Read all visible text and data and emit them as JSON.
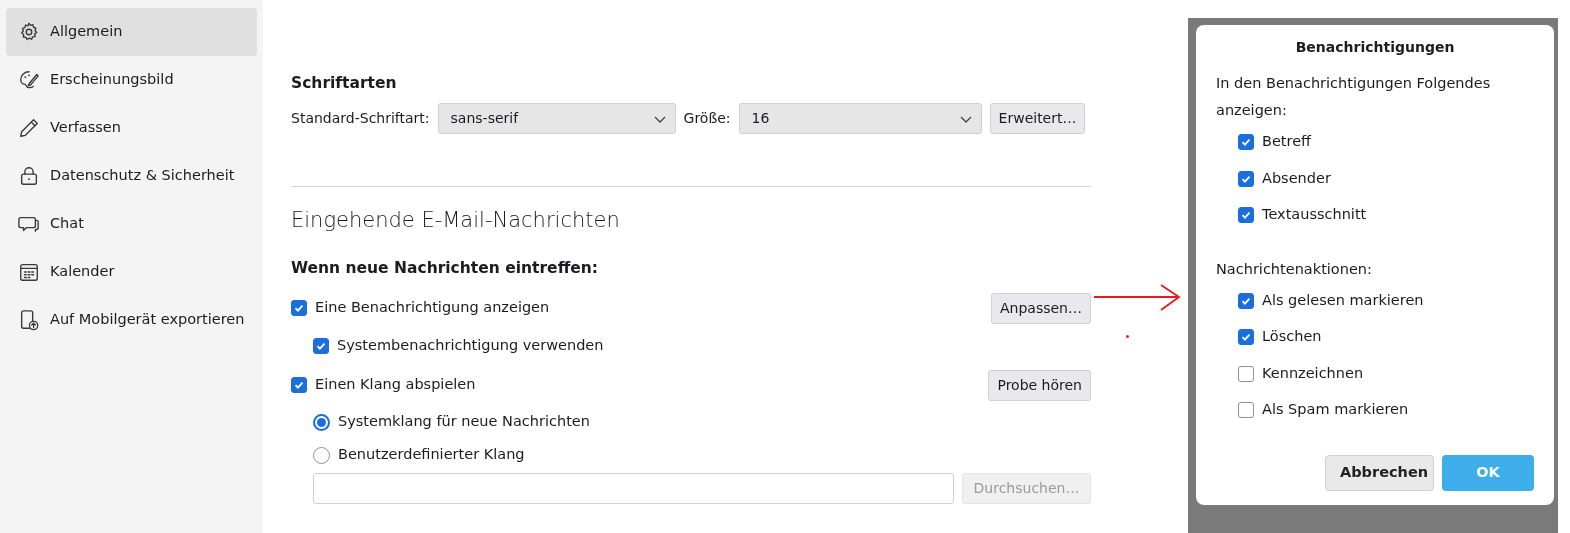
{
  "sidebar": {
    "items": [
      {
        "label": "Allgemein",
        "selected": true
      },
      {
        "label": "Erscheinungsbild",
        "selected": false
      },
      {
        "label": "Verfassen",
        "selected": false
      },
      {
        "label": "Datenschutz & Sicherheit",
        "selected": false
      },
      {
        "label": "Chat",
        "selected": false
      },
      {
        "label": "Kalender",
        "selected": false
      },
      {
        "label": "Auf Mobilgerät exportieren",
        "selected": false
      }
    ]
  },
  "fonts": {
    "heading": "Schriftarten",
    "default_font": {
      "label": "Standard-Schriftart:",
      "value": "sans-serif"
    },
    "size": {
      "label": "Größe:",
      "value": "16"
    },
    "advanced_button": "Erweitert…"
  },
  "incoming": {
    "heading": "Eingehende E-Mail-Nachrichten",
    "subheading": "Wenn neue Nachrichten eintreffen:",
    "show_alert": {
      "label": "Eine Benachrichtigung anzeigen",
      "checked": true,
      "button": "Anpassen…"
    },
    "system_notification": {
      "label": "Systembenachrichtigung verwenden",
      "checked": true
    },
    "play_sound": {
      "label": "Einen Klang abspielen",
      "checked": true,
      "button": "Probe hören"
    },
    "sound_choices": [
      {
        "label": "Systemklang für neue Nachrichten",
        "selected": true
      },
      {
        "label": "Benutzerdefinierter Klang",
        "selected": false
      }
    ],
    "sound_file": {
      "browse_button": "Durchsuchen…",
      "disabled": true
    }
  },
  "dialog": {
    "title": "Benachrichtigungen",
    "show_label": "In den Benachrichtigungen Folgendes anzeigen:",
    "show_items": [
      {
        "label": "Betreff",
        "checked": true
      },
      {
        "label": "Absender",
        "checked": true
      },
      {
        "label": "Textausschnitt",
        "checked": true
      }
    ],
    "actions_label": "Nachrichtenaktionen:",
    "action_items": [
      {
        "label": "Als gelesen markieren",
        "checked": true
      },
      {
        "label": "Löschen",
        "checked": true
      },
      {
        "label": "Kennzeichnen",
        "checked": false
      },
      {
        "label": "Als Spam markieren",
        "checked": false
      }
    ],
    "cancel_button": "Abbrechen",
    "ok_button": "OK"
  }
}
